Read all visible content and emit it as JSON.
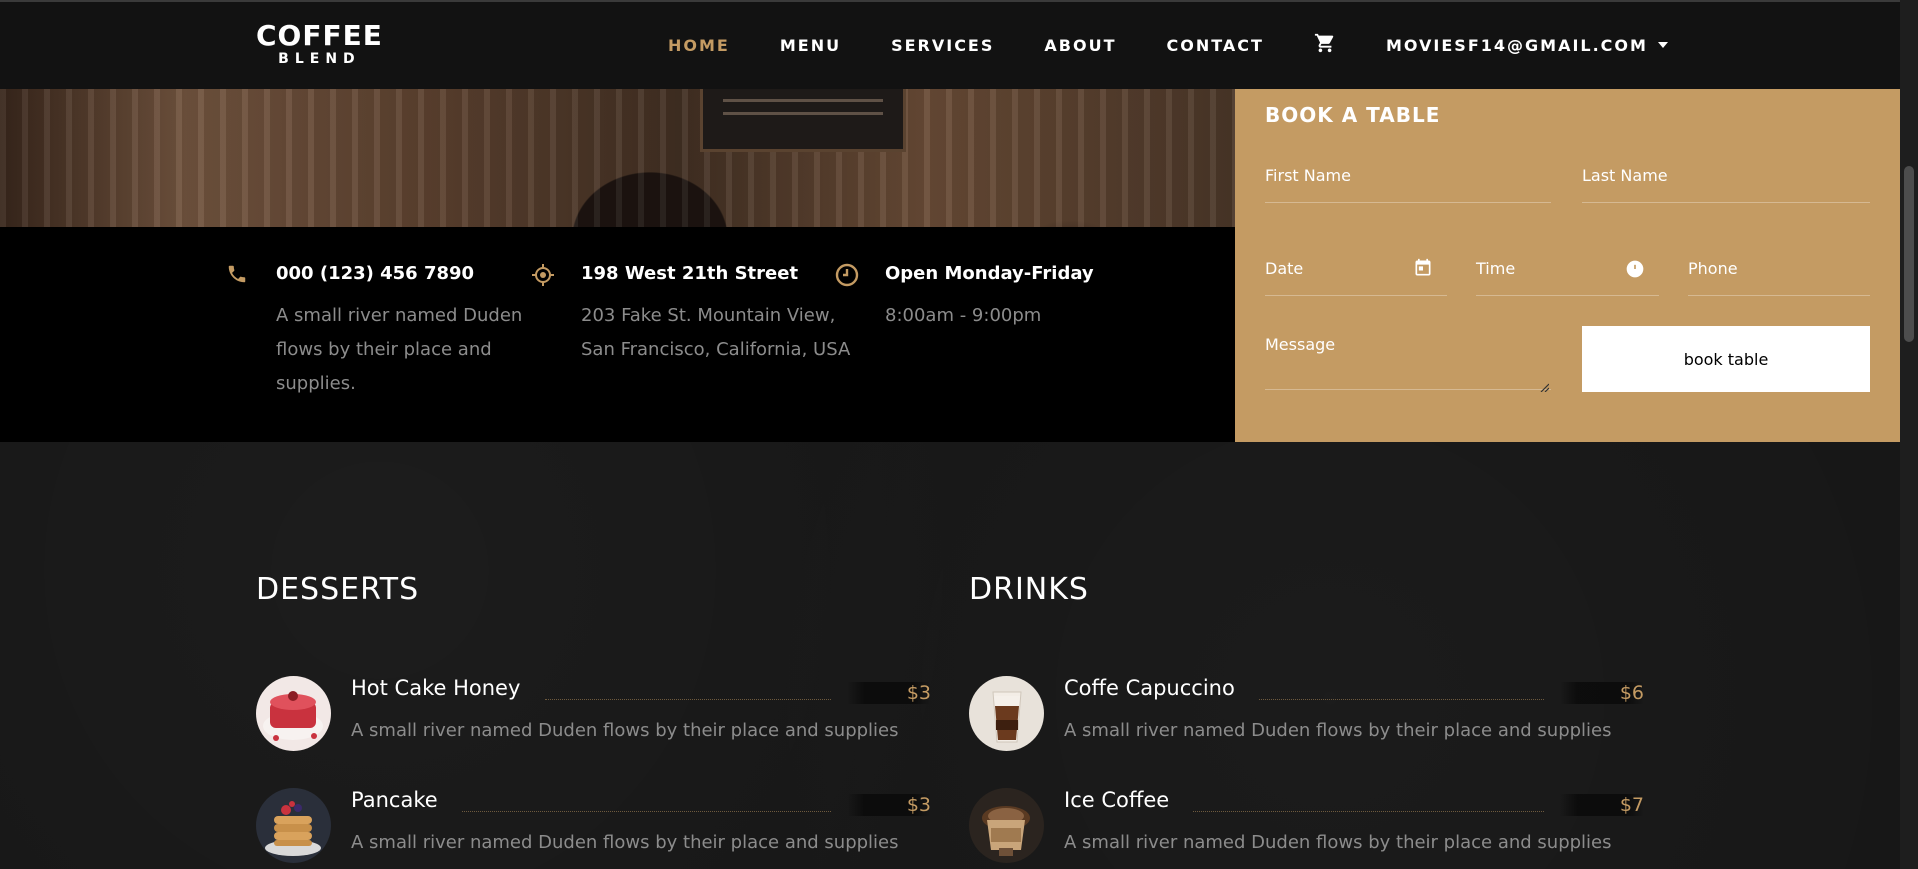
{
  "brand": {
    "line1": "COFFEE",
    "line2": "BLEND"
  },
  "nav": {
    "items": [
      {
        "label": "HOME",
        "active": true
      },
      {
        "label": "MENU",
        "active": false
      },
      {
        "label": "SERVICES",
        "active": false
      },
      {
        "label": "ABOUT",
        "active": false
      },
      {
        "label": "CONTACT",
        "active": false
      }
    ],
    "cart_icon": "cart-icon",
    "email": "MOVIESF14@GMAIL.COM"
  },
  "info": [
    {
      "icon": "phone-icon",
      "title": "000 (123) 456 7890",
      "text": "A small river named Duden flows by their place and supplies."
    },
    {
      "icon": "location-icon",
      "title": "198 West 21th Street",
      "text": "203 Fake St. Mountain View, San Francisco, California, USA"
    },
    {
      "icon": "clock-icon",
      "title": "Open Monday-Friday",
      "text": "8:00am - 9:00pm"
    }
  ],
  "booking": {
    "title": "BOOK A TABLE",
    "first_name": "First Name",
    "last_name": "Last Name",
    "date": "Date",
    "time": "Time",
    "phone": "Phone",
    "message": "Message",
    "button": "book table"
  },
  "desserts": {
    "title": "DESSERTS",
    "items": [
      {
        "name": "Hot Cake Honey",
        "price": "$3",
        "desc": "A small river named Duden flows by their place and supplies"
      },
      {
        "name": "Pancake",
        "price": "$3",
        "desc": "A small river named Duden flows by their place and supplies"
      }
    ]
  },
  "drinks": {
    "title": "DRINKS",
    "items": [
      {
        "name": "Coffe Capuccino",
        "price": "$6",
        "desc": "A small river named Duden flows by their place and supplies"
      },
      {
        "name": "Ice Coffee",
        "price": "$7",
        "desc": "A small river named Duden flows by their place and supplies"
      }
    ]
  },
  "colors": {
    "accent": "#c49b63",
    "nav_bg": "#121212",
    "info_bg": "#000000",
    "menu_bg": "#171717"
  }
}
